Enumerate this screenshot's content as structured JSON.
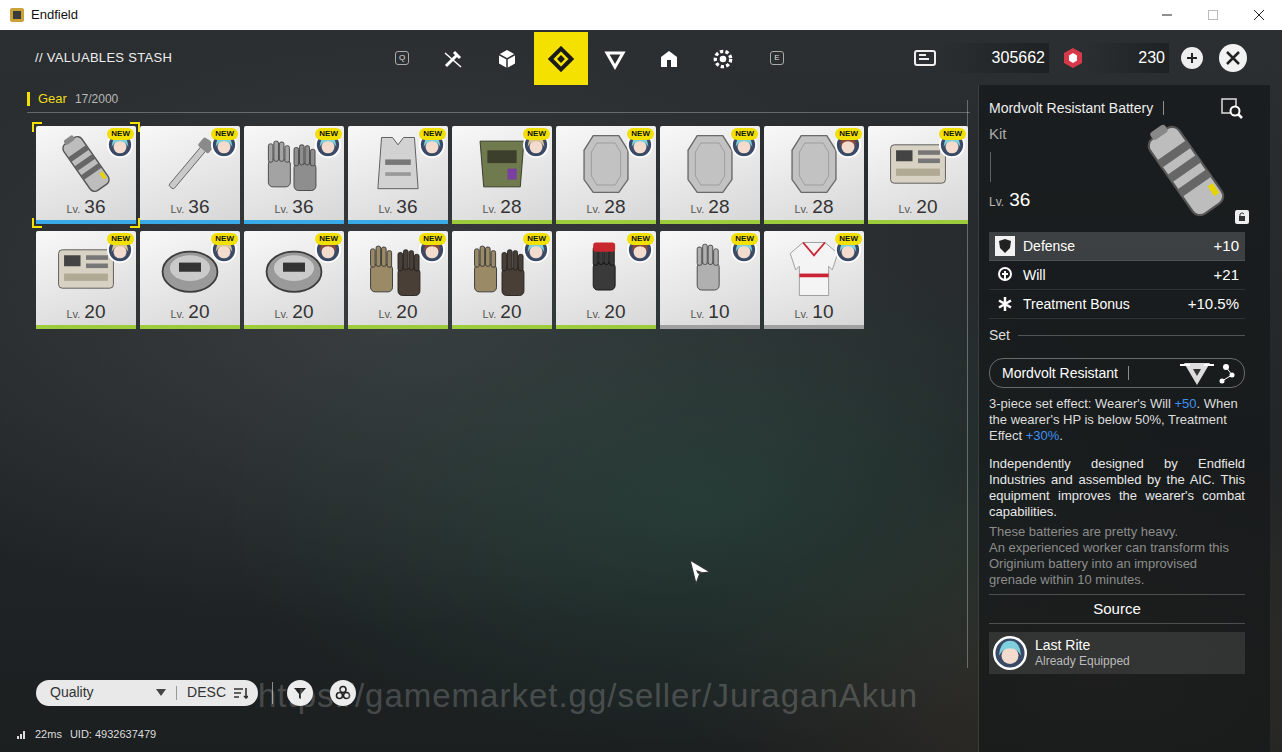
{
  "window": {
    "title": "Endfield"
  },
  "header": {
    "title": "// VALUABLES STASH",
    "prev_key": "Q",
    "next_key": "E",
    "tabs": [
      {
        "kind": "weapon",
        "selected": false
      },
      {
        "kind": "cube",
        "selected": false
      },
      {
        "kind": "gear",
        "selected": true
      },
      {
        "kind": "triangle",
        "selected": false
      },
      {
        "kind": "box",
        "selected": false
      },
      {
        "kind": "cog",
        "selected": false
      }
    ],
    "currencies": [
      {
        "kind": "ticket",
        "amount": "305662"
      },
      {
        "kind": "origeometry",
        "amount": "230"
      }
    ]
  },
  "section": {
    "label": "Gear",
    "count": "17/2000"
  },
  "level_prefix": "Lv.",
  "new_badge": "NEW",
  "items": [
    {
      "kind": "battery",
      "level": "36",
      "color": "#3aa9e8",
      "hair": "#7fd0de",
      "new": true,
      "selected": true
    },
    {
      "kind": "rod",
      "level": "36",
      "color": "#3aa9e8",
      "hair": "#7fd0de",
      "new": true,
      "selected": false
    },
    {
      "kind": "gloves",
      "level": "36",
      "color": "#3aa9e8",
      "hair": "#7fd0de",
      "new": true,
      "selected": false
    },
    {
      "kind": "vest",
      "level": "36",
      "color": "#3aa9e8",
      "hair": "#7fd0de",
      "new": true,
      "selected": false
    },
    {
      "kind": "armor",
      "level": "28",
      "color": "#9ccc3c",
      "hair": "#d8c49a",
      "new": true,
      "selected": false
    },
    {
      "kind": "plate",
      "level": "28",
      "color": "#9ccc3c",
      "hair": "#7fd0de",
      "new": true,
      "selected": false
    },
    {
      "kind": "plate",
      "level": "28",
      "color": "#9ccc3c",
      "hair": "#7fd0de",
      "new": true,
      "selected": false
    },
    {
      "kind": "plate",
      "level": "28",
      "color": "#9ccc3c",
      "hair": "#8a4a3a",
      "new": true,
      "selected": false
    },
    {
      "kind": "device",
      "level": "20",
      "color": "#9ccc3c",
      "hair": "#7fd0de",
      "new": true,
      "selected": false
    },
    {
      "kind": "device",
      "level": "20",
      "color": "#9ccc3c",
      "hair": "#d8c49a",
      "new": true,
      "selected": false
    },
    {
      "kind": "disc",
      "level": "20",
      "color": "#9ccc3c",
      "hair": "#d8c49a",
      "new": true,
      "selected": false
    },
    {
      "kind": "disc",
      "level": "20",
      "color": "#9ccc3c",
      "hair": "#8a4a3a",
      "new": true,
      "selected": false
    },
    {
      "kind": "gauntlet",
      "level": "20",
      "color": "#9ccc3c",
      "hair": "#8a4a3a",
      "new": true,
      "selected": false
    },
    {
      "kind": "gauntlet",
      "level": "20",
      "color": "#9ccc3c",
      "hair": "#7fd0de",
      "new": true,
      "selected": false
    },
    {
      "kind": "redglove",
      "level": "20",
      "color": "#9ccc3c",
      "hair": "#8a4a3a",
      "new": true,
      "selected": false
    },
    {
      "kind": "glove",
      "level": "10",
      "color": "#a0a0a0",
      "hair": "#7fd0de",
      "new": true,
      "selected": false
    },
    {
      "kind": "jacket",
      "level": "10",
      "color": "#a0a0a0",
      "hair": "#7fd0de",
      "new": true,
      "selected": false
    }
  ],
  "detail": {
    "name": "Mordvolt Resistant Battery",
    "type": "Kit",
    "level": "36",
    "locked": false,
    "stats": [
      {
        "kind": "defense",
        "name": "Defense",
        "value": "+10",
        "highlighted": true
      },
      {
        "kind": "will",
        "name": "Will",
        "value": "+21",
        "highlighted": false
      },
      {
        "kind": "treatment",
        "name": "Treatment Bonus",
        "value": "+10.5%",
        "highlighted": false
      }
    ],
    "set": {
      "heading": "Set",
      "name": "Mordvolt Resistant",
      "effect": [
        {
          "text": "3-piece set effect: Wearer's Will ",
          "highlight": false
        },
        {
          "text": "+50",
          "highlight": true
        },
        {
          "text": ". When the wearer's HP is below 50%, Treatment Effect ",
          "highlight": false
        },
        {
          "text": "+30%",
          "highlight": true
        },
        {
          "text": ".",
          "highlight": false
        }
      ]
    },
    "description": "Independently designed by Endfield Industries and assembled by the AIC. This equipment improves the wearer's combat capabilities.",
    "flavor": [
      "These batteries are pretty heavy.",
      "An experienced worker can transform this Originium battery into an improvised grenade within 10 minutes."
    ],
    "source": {
      "heading": "Source",
      "name": "Last Rite",
      "status": "Already Equipped",
      "hair": "#7fd0de"
    }
  },
  "footer": {
    "sort": "Quality",
    "order": "DESC",
    "ping": "22ms",
    "uid": "UID: 4932637479"
  },
  "watermark": "https://gamemarket.gg/seller/JuraganAkun"
}
